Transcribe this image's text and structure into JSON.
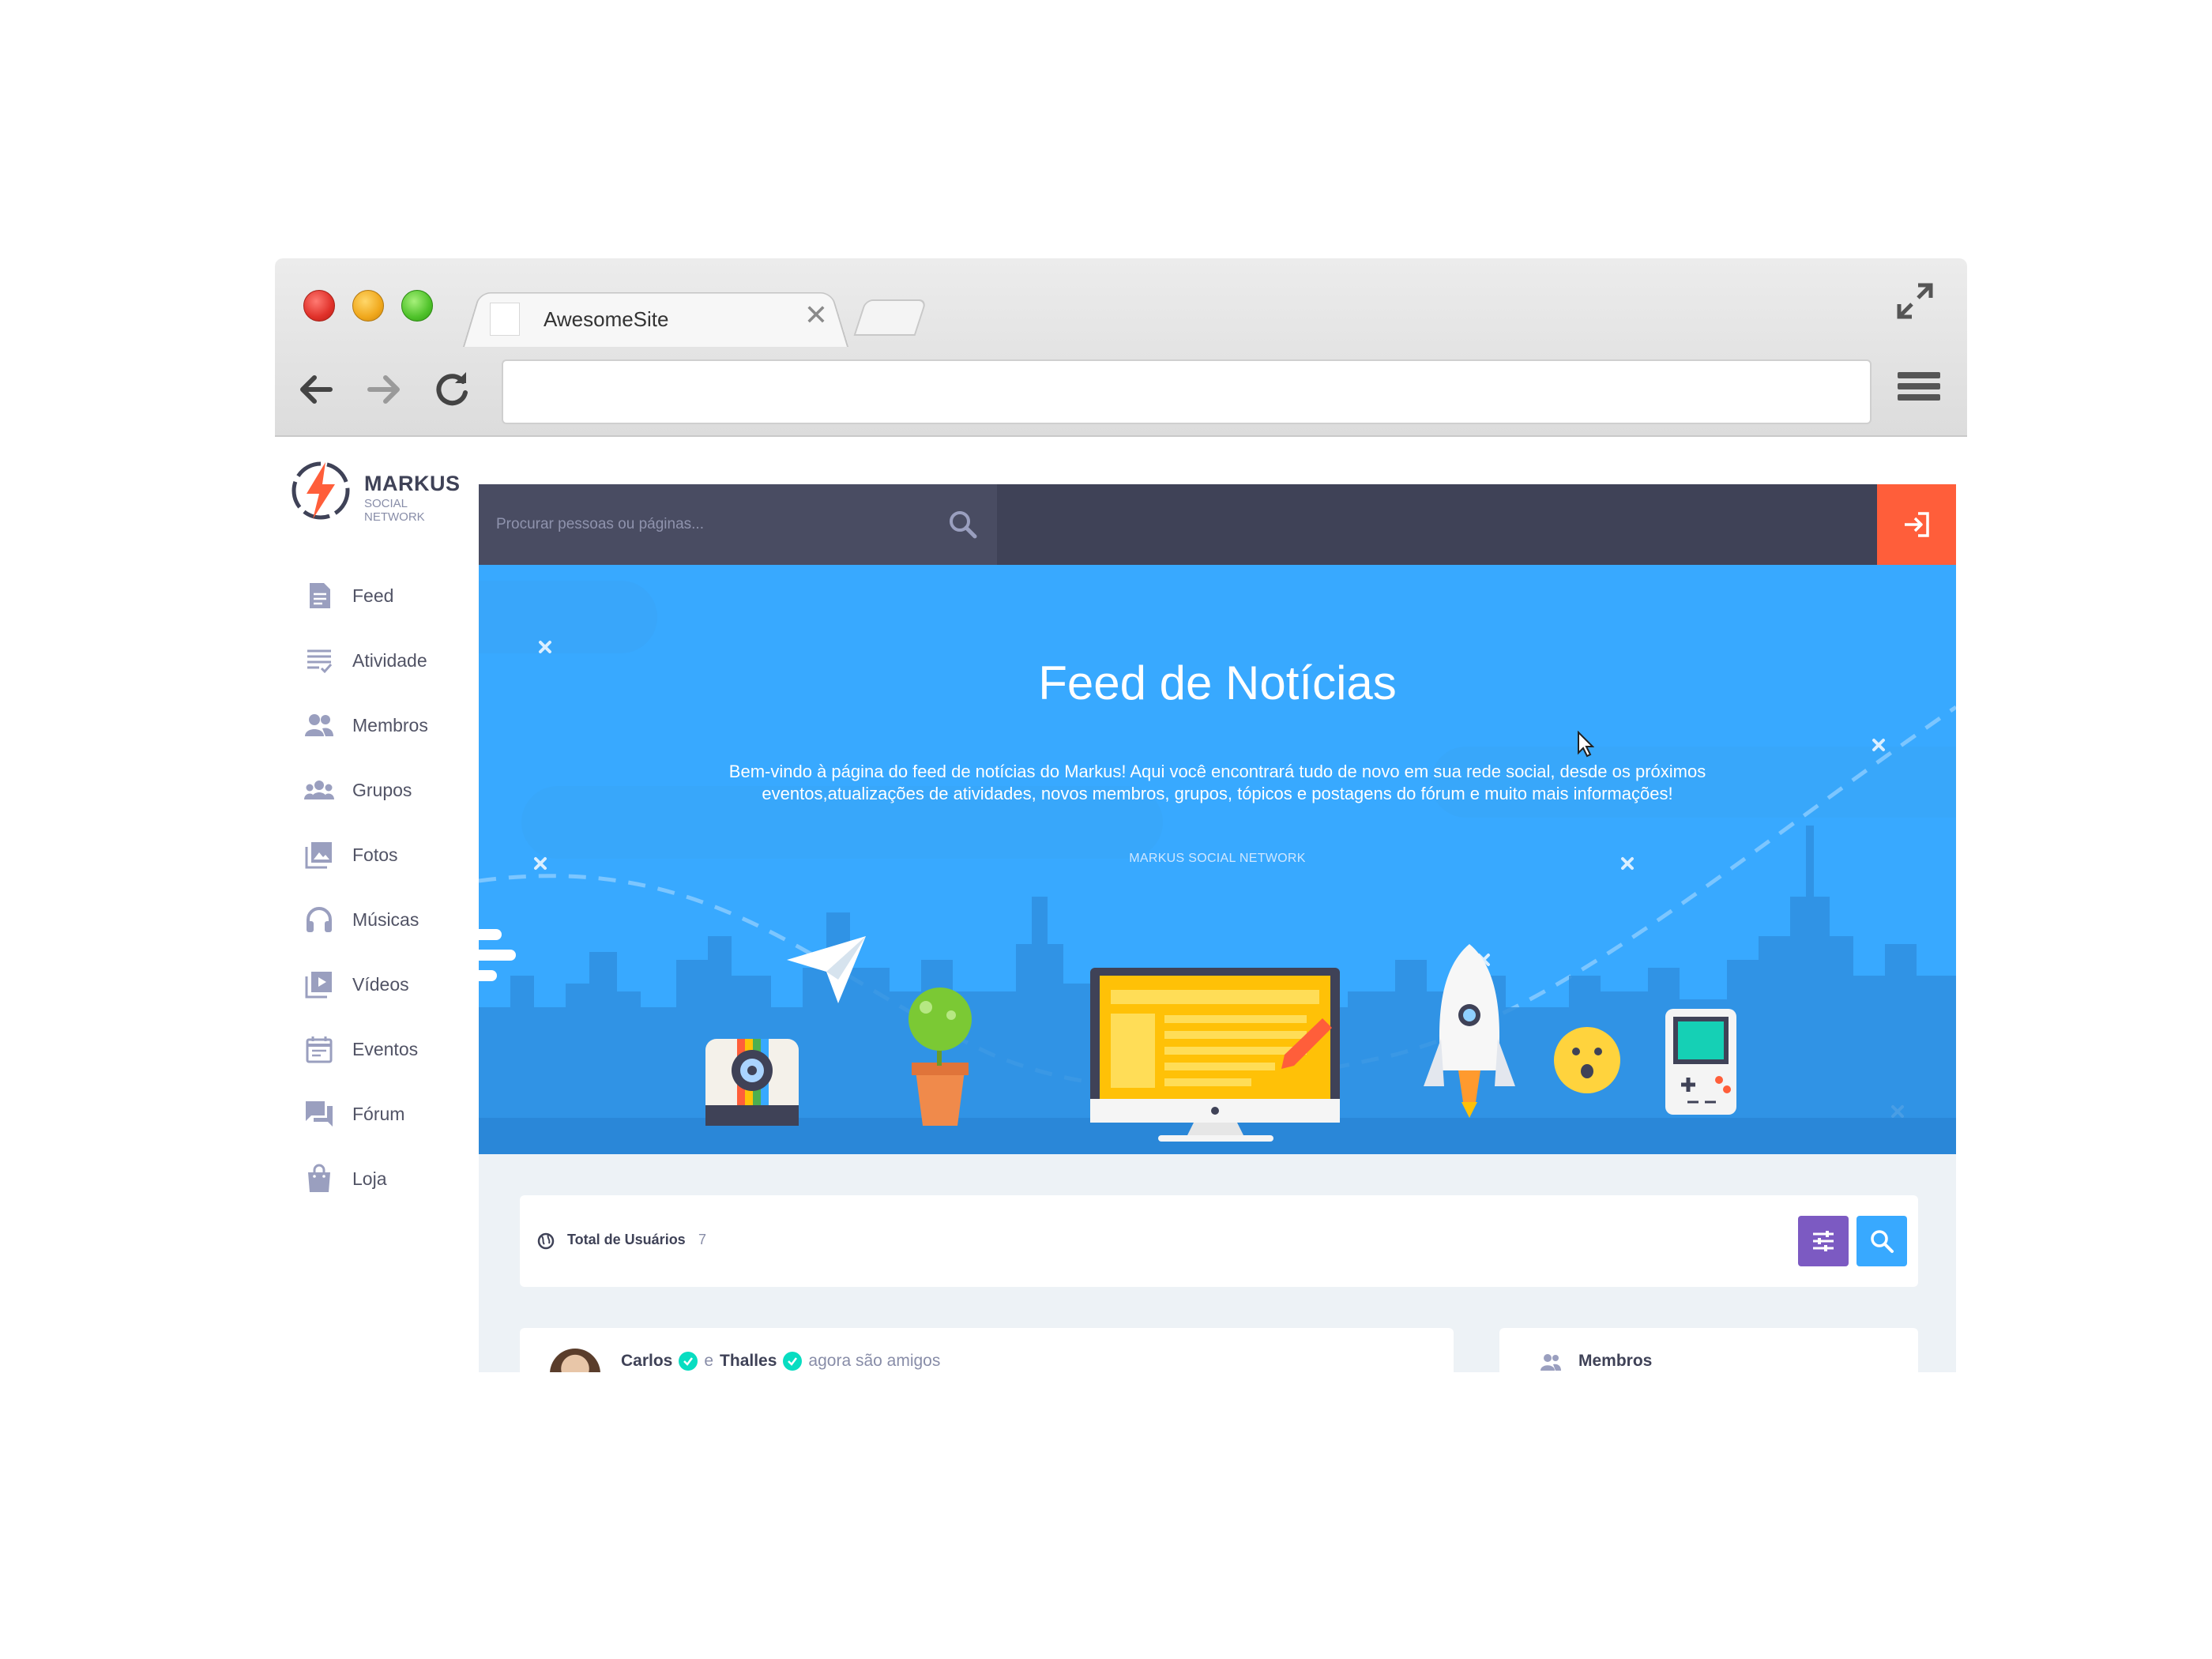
{
  "browser": {
    "tab_title": "AwesomeSite",
    "tab_close": "✕",
    "address": ""
  },
  "sidebar": {
    "logo_title": "MARKUS",
    "logo_subtitle": "SOCIAL NETWORK",
    "items": [
      {
        "label": "Feed",
        "icon": "document-icon"
      },
      {
        "label": "Atividade",
        "icon": "activity-list-icon"
      },
      {
        "label": "Membros",
        "icon": "members-icon"
      },
      {
        "label": "Grupos",
        "icon": "groups-icon"
      },
      {
        "label": "Fotos",
        "icon": "photos-icon"
      },
      {
        "label": "Músicas",
        "icon": "headphones-icon"
      },
      {
        "label": "Vídeos",
        "icon": "video-icon"
      },
      {
        "label": "Eventos",
        "icon": "calendar-icon"
      },
      {
        "label": "Fórum",
        "icon": "forum-icon"
      },
      {
        "label": "Loja",
        "icon": "shopping-bag-icon"
      }
    ]
  },
  "topbar": {
    "search_placeholder": "Procurar pessoas ou páginas...",
    "login_icon": "login-icon"
  },
  "hero": {
    "title": "Feed de Notícias",
    "text": "Bem-vindo à página do feed de notícias do Markus! Aqui você encontrará tudo de novo em sua rede social, desde os próximos eventos,atualizações de atividades, novos membros, grupos, tópicos e postagens do fórum e muito mais informações!",
    "subtitle": "MARKUS SOCIAL NETWORK"
  },
  "stats": {
    "label": "Total de Usuários",
    "count": "7"
  },
  "post": {
    "user1": "Carlos",
    "connector": "e",
    "user2": "Thalles",
    "action": "agora são amigos"
  },
  "members_widget": {
    "label": "Membros"
  },
  "colors": {
    "topbar": "#3f4257",
    "hero": "#38a9ff",
    "login_button": "#ff5e3a",
    "filter_button": "#7c5ac2",
    "search_button": "#38a9ff"
  }
}
